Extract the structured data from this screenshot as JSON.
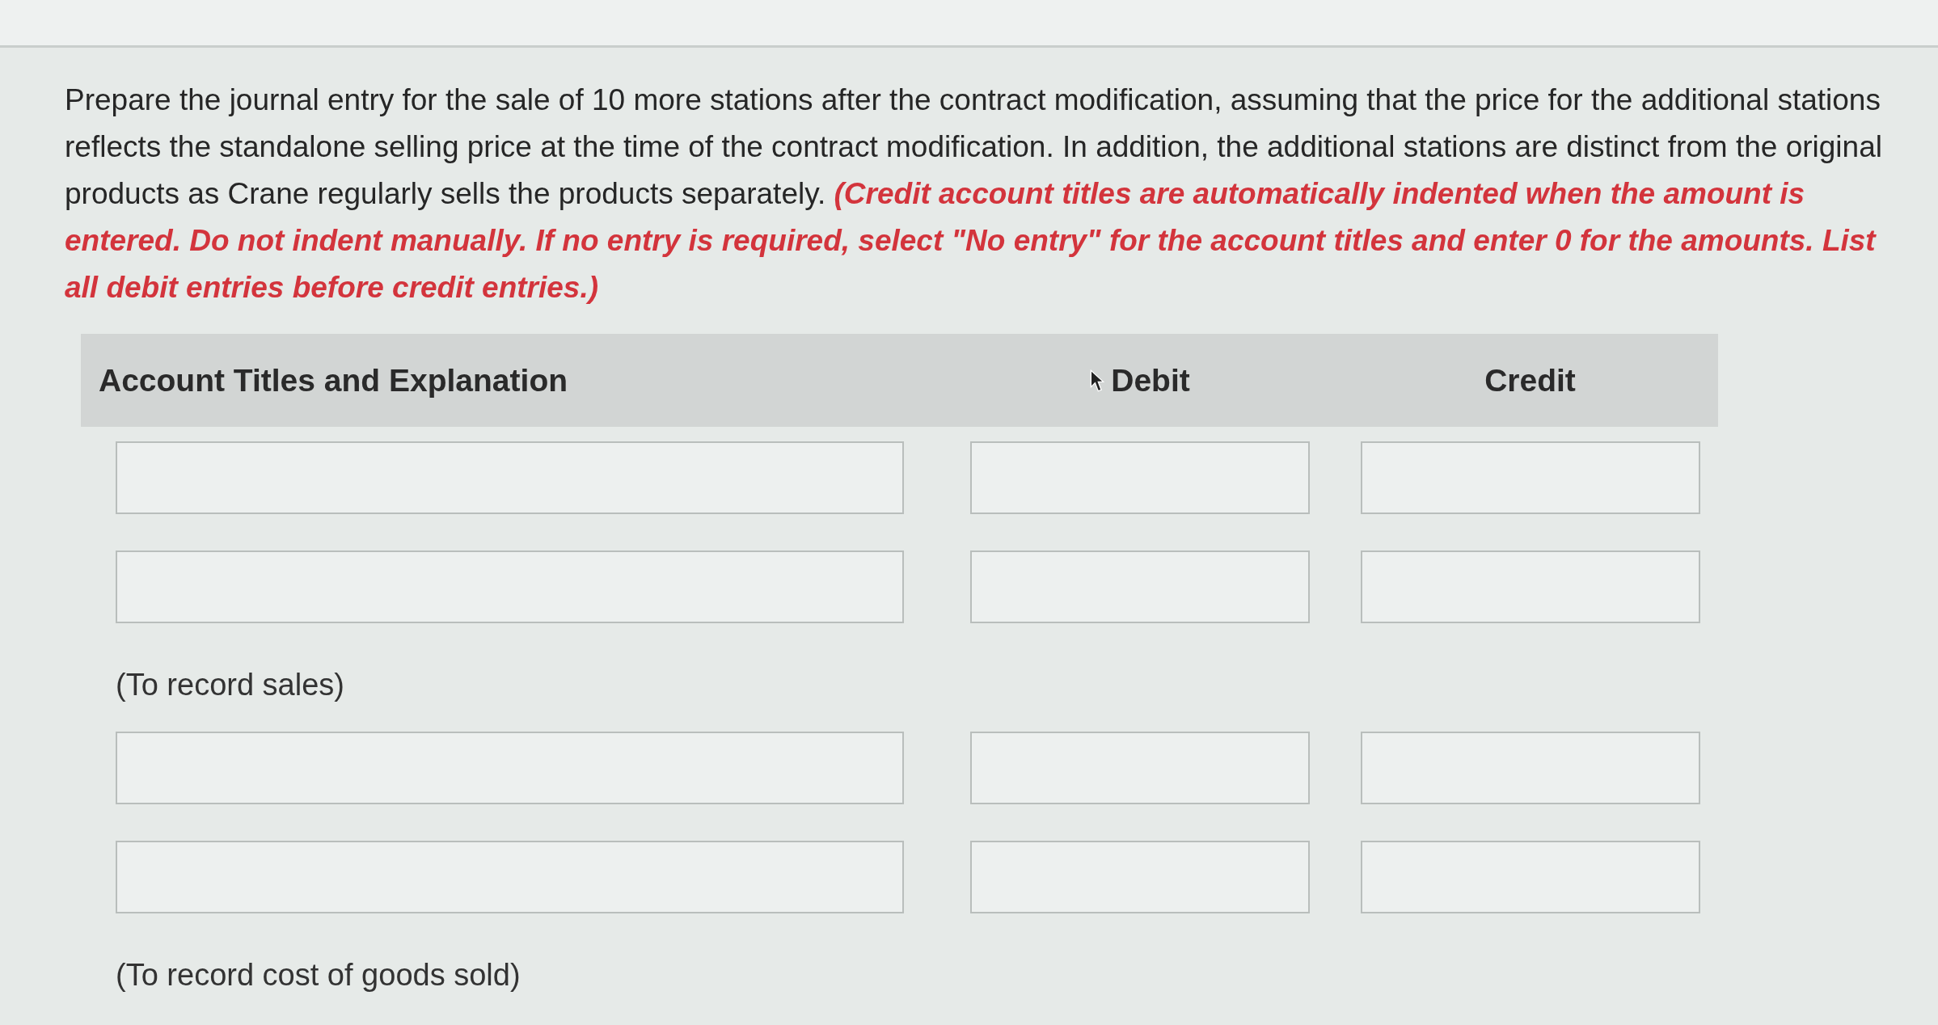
{
  "question": {
    "text": "Prepare the journal entry for the sale of 10 more stations after the contract modification, assuming that the price for the additional stations reflects the standalone selling price at the time of the contract modification. In addition, the additional stations are distinct from the original products as Crane regularly sells the products separately. **(Credit account titles are automatically indented when the amount is entered. Do not indent manually. If no entry is required, select \"No entry\" for the account titles and enter 0 for the amounts. List all debit entries before credit entries.)**"
  },
  "table": {
    "columns": [
      {
        "label": "Account Titles and Explanation",
        "kind": "account"
      },
      {
        "label": "Debit",
        "kind": "amount",
        "pointer": true
      },
      {
        "label": "Credit",
        "kind": "amount",
        "pointer": false
      }
    ],
    "entries": [
      {
        "rows": [
          {
            "kind": "input-row"
          },
          {
            "kind": "input-row"
          }
        ],
        "note": "(To record sales)"
      },
      {
        "rows": [
          {
            "kind": "input-row"
          },
          {
            "kind": "input-row"
          }
        ],
        "note": "(To record cost of goods sold)"
      }
    ]
  }
}
